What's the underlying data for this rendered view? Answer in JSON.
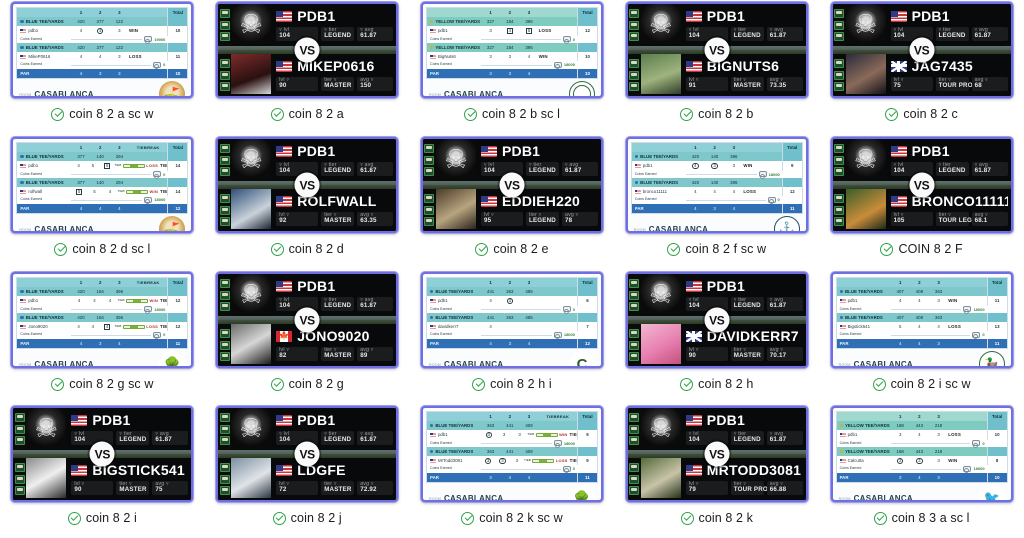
{
  "page": {
    "layout": "gallery-grid",
    "columns": 5,
    "rows": 4,
    "accent_border": "#6f6fe0",
    "check_color": "#2fa34a"
  },
  "labels": {
    "vs": "VS",
    "room_label": "ROOM",
    "prize_label": "PRIZE",
    "room_value": "CASABLANCA",
    "prize_value": "18000",
    "par_label": "PAR",
    "total_label": "Total",
    "tiebreak_label": "TIEBREAK",
    "coins_earned_label": "Coins Earned",
    "blue_tee": "BLUE TEE/YARDS",
    "yellow_tee": "YELLOW TEE/YARDS",
    "lvl_label": "lvl",
    "tier_label": "tier",
    "avg_label": "avg",
    "result_win": "WIN",
    "result_loss": "LOSS",
    "result_tie": "TIE"
  },
  "hero": {
    "name": "PDB1",
    "flag": "us",
    "lvl": "104",
    "tier": "LEGEND",
    "avg": "61.87",
    "avatar": "skull"
  },
  "items": [
    {
      "kind": "scorecard",
      "caption": "coin 8 2 a sc w",
      "tee": "blue",
      "logo": "lg-1",
      "rows": [
        {
          "type": "tee",
          "cells": [
            "420",
            "377",
            "122"
          ]
        },
        {
          "type": "player",
          "name": "pdb1",
          "cells": [
            "4",
            "3",
            "3"
          ],
          "marks": [
            "",
            "circle",
            ""
          ],
          "result": "WIN",
          "total": "10",
          "coins": "19000"
        },
        {
          "type": "tee",
          "cells": [
            "420",
            "377",
            "122"
          ]
        },
        {
          "type": "player",
          "name": "MikeP0616",
          "cells": [
            "4",
            "4",
            "3"
          ],
          "marks": [
            "",
            "",
            ""
          ],
          "result": "LOSS",
          "total": "11",
          "coins": "0"
        }
      ],
      "par": [
        "4",
        "3",
        "3"
      ],
      "par_total": "10"
    },
    {
      "kind": "vs",
      "caption": "coin 8 2 a",
      "opponent": {
        "name": "MIKEP0616",
        "flag": "us",
        "lvl": "90",
        "tier": "MASTER",
        "avg": "150",
        "avatar": "av-photo-1"
      }
    },
    {
      "kind": "scorecard",
      "caption": "coin 8 2 b sc l",
      "tee": "yellow",
      "logo": "lg-2",
      "rows": [
        {
          "type": "tee",
          "cells": [
            "327",
            "184",
            "396"
          ]
        },
        {
          "type": "player",
          "name": "pdb1",
          "cells": [
            "3",
            "4",
            "5"
          ],
          "marks": [
            "",
            "square",
            "square"
          ],
          "result": "LOSS",
          "total": "12",
          "coins": "0"
        },
        {
          "type": "tee",
          "cells": [
            "327",
            "184",
            "396"
          ]
        },
        {
          "type": "player",
          "name": "BigNuts6",
          "cells": [
            "3",
            "3",
            "4"
          ],
          "marks": [
            "",
            "",
            ""
          ],
          "result": "WIN",
          "total": "10",
          "coins": "18000"
        }
      ],
      "par": [
        "3",
        "3",
        "4"
      ],
      "par_total": "10"
    },
    {
      "kind": "vs",
      "caption": "coin 8 2 b",
      "opponent": {
        "name": "BIGNUTS6",
        "flag": "us",
        "lvl": "91",
        "tier": "MASTER",
        "avg": "73.35",
        "avatar": "av-photo-2"
      }
    },
    {
      "kind": "vs",
      "caption": "coin 8 2 c",
      "opponent": {
        "name": "JAG7435",
        "flag": "uk",
        "lvl": "75",
        "tier": "TOUR PRO",
        "avg": "68",
        "avatar": "av-photo-6"
      }
    },
    {
      "kind": "scorecard",
      "caption": "coin 8 2 d sc l",
      "tee": "blue",
      "logo": "lg-1",
      "tiebreak": true,
      "rows": [
        {
          "type": "tee",
          "cells": [
            "377",
            "140",
            "294"
          ]
        },
        {
          "type": "player",
          "name": "pdb1",
          "cells": [
            "4",
            "5",
            "5"
          ],
          "marks": [
            "",
            "",
            "square"
          ],
          "result": "TIE",
          "total": "14",
          "coins": "0",
          "tb": "LOSS"
        },
        {
          "type": "tee",
          "cells": [
            "377",
            "140",
            "294"
          ]
        },
        {
          "type": "player",
          "name": "rolfwall",
          "cells": [
            "5",
            "5",
            "4"
          ],
          "marks": [
            "square",
            "",
            ""
          ],
          "result": "TIE",
          "total": "14",
          "coins": "18000",
          "tb": "WIN"
        }
      ],
      "par": [
        "4",
        "4",
        "4"
      ],
      "par_total": "12"
    },
    {
      "kind": "vs",
      "caption": "coin 8 2 d",
      "opponent": {
        "name": "ROLFWALL",
        "flag": "us",
        "lvl": "92",
        "tier": "MASTER",
        "avg": "63.35",
        "avatar": "av-photo-3"
      }
    },
    {
      "kind": "vs",
      "caption": "coin 8 2 e",
      "opponent": {
        "name": "EDDIEH220",
        "flag": "us",
        "lvl": "95",
        "tier": "LEGEND",
        "avg": "78",
        "avatar": "av-photo-4"
      }
    },
    {
      "kind": "scorecard",
      "caption": "coin 8 2 f sc w",
      "tee": "blue",
      "logo": "lg-4",
      "rows": [
        {
          "type": "tee",
          "cells": [
            "420",
            "140",
            "396"
          ]
        },
        {
          "type": "player",
          "name": "pdb1",
          "cells": [
            "4",
            "3",
            "3"
          ],
          "marks": [
            "circle",
            "circle",
            ""
          ],
          "result": "WIN",
          "total": "9",
          "coins": "18000"
        },
        {
          "type": "tee",
          "cells": [
            "420",
            "140",
            "396"
          ]
        },
        {
          "type": "player",
          "name": "bronco11111",
          "cells": [
            "4",
            "4",
            "4"
          ],
          "marks": [
            "",
            "",
            ""
          ],
          "result": "LOSS",
          "total": "12",
          "coins": "0"
        }
      ],
      "par": [
        "4",
        "3",
        "4"
      ],
      "par_total": "11"
    },
    {
      "kind": "vs",
      "caption": "COIN 8 2 F",
      "opponent": {
        "name": "BRONCO11111",
        "flag": "us",
        "lvl": "105",
        "tier": "TOUR LEGEND",
        "avg": "68.1",
        "avatar": "av-photo-8"
      }
    },
    {
      "kind": "scorecard",
      "caption": "coin 8 2 g sc w",
      "tee": "blue",
      "logo": "lg-6",
      "tiebreak": true,
      "rows": [
        {
          "type": "tee",
          "cells": [
            "420",
            "184",
            "396"
          ]
        },
        {
          "type": "player",
          "name": "pdb1",
          "cells": [
            "4",
            "4",
            "4"
          ],
          "marks": [
            "",
            "",
            ""
          ],
          "result": "TIE",
          "total": "12",
          "coins": "18000",
          "tb": "WIN"
        },
        {
          "type": "tee",
          "cells": [
            "420",
            "184",
            "396"
          ]
        },
        {
          "type": "player",
          "name": "Jono9020",
          "cells": [
            "4",
            "4",
            "4"
          ],
          "marks": [
            "",
            "",
            "square"
          ],
          "result": "TIE",
          "total": "12",
          "coins": "0",
          "tb": "LOSS"
        }
      ],
      "par": [
        "4",
        "3",
        "4"
      ],
      "par_total": "11"
    },
    {
      "kind": "vs",
      "caption": "coin 8 2 g",
      "opponent": {
        "name": "JONO9020",
        "flag": "ca",
        "lvl": "82",
        "tier": "MASTER",
        "avg": "89",
        "avatar": "av-photo-5"
      }
    },
    {
      "kind": "scorecard",
      "caption": "coin 8 2 h i",
      "tee": "blue",
      "logo": "lg-3",
      "rows": [
        {
          "type": "tee",
          "cells": [
            "441",
            "363",
            "485"
          ]
        },
        {
          "type": "player",
          "name": "pdb1",
          "cells": [
            "4",
            "3",
            ""
          ],
          "marks": [
            "",
            "circle",
            ""
          ],
          "result": "",
          "total": "6",
          "coins": "0"
        },
        {
          "type": "tee",
          "cells": [
            "441",
            "363",
            "485"
          ]
        },
        {
          "type": "player",
          "name": "davidkerr7",
          "cells": [
            "4",
            "",
            ""
          ],
          "marks": [
            "",
            "",
            ""
          ],
          "result": "",
          "total": "7",
          "coins": "18000"
        }
      ],
      "par": [
        "4",
        "3",
        "4"
      ],
      "par_total": "12"
    },
    {
      "kind": "vs",
      "caption": "coin 8 2 h",
      "opponent": {
        "name": "DAVIDKERR7",
        "flag": "uk",
        "lvl": "90",
        "tier": "MASTER",
        "avg": "70.17",
        "avatar": "av-photo-7"
      }
    },
    {
      "kind": "scorecard",
      "caption": "coin 8 2 i sc w",
      "tee": "blue",
      "logo": "lg-5",
      "rows": [
        {
          "type": "tee",
          "cells": [
            "407",
            "408",
            "363"
          ]
        },
        {
          "type": "player",
          "name": "pdb1",
          "cells": [
            "4",
            "4",
            "3"
          ],
          "marks": [
            "",
            "",
            ""
          ],
          "result": "WIN",
          "total": "11",
          "coins": "18000"
        },
        {
          "type": "tee",
          "cells": [
            "407",
            "408",
            "363"
          ]
        },
        {
          "type": "player",
          "name": "Bigstick541",
          "cells": [
            "5",
            "4",
            "4"
          ],
          "marks": [
            "",
            "",
            ""
          ],
          "result": "LOSS",
          "total": "13",
          "coins": "0"
        }
      ],
      "par": [
        "4",
        "4",
        "3"
      ],
      "par_total": "11"
    },
    {
      "kind": "vs",
      "caption": "coin 8 2 i",
      "opponent": {
        "name": "BIGSTICK541",
        "flag": "us",
        "lvl": "90",
        "tier": "MASTER",
        "avg": "75",
        "avatar": "av-photo-11"
      }
    },
    {
      "kind": "vs",
      "caption": "coin 8 2 j",
      "opponent": {
        "name": "LDGFE",
        "flag": "us",
        "lvl": "72",
        "tier": "MASTER",
        "avg": "72.92",
        "avatar": "av-photo-9"
      }
    },
    {
      "kind": "scorecard",
      "caption": "coin 8 2 k sc w",
      "tee": "blue",
      "logo": "lg-6",
      "tiebreak": true,
      "rows": [
        {
          "type": "tee",
          "cells": [
            "363",
            "441",
            "408"
          ]
        },
        {
          "type": "player",
          "name": "pdb1",
          "cells": [
            "3",
            "3",
            "3"
          ],
          "marks": [
            "circle",
            "",
            ""
          ],
          "result": "TIE",
          "total": "9",
          "coins": "18000",
          "tb": "WIN"
        },
        {
          "type": "tee",
          "cells": [
            "363",
            "441",
            "408"
          ]
        },
        {
          "type": "player",
          "name": "MrTodd3081",
          "cells": [
            "3",
            "3",
            "3"
          ],
          "marks": [
            "circle",
            "circle",
            ""
          ],
          "result": "TIE",
          "total": "9",
          "coins": "0",
          "tb": "LOSS"
        }
      ],
      "par": [
        "3",
        "4",
        "4"
      ],
      "par_total": "11"
    },
    {
      "kind": "vs",
      "caption": "coin 8 2 k",
      "opponent": {
        "name": "MRTODD3081",
        "flag": "us",
        "lvl": "79",
        "tier": "TOUR PRO",
        "avg": "66.88",
        "avatar": "av-photo-10"
      }
    },
    {
      "kind": "scorecard",
      "caption": "coin 8 3 a sc l",
      "tee": "yellow",
      "logo": "lg-7",
      "rows": [
        {
          "type": "tee",
          "cells": [
            "188",
            "443",
            "218"
          ]
        },
        {
          "type": "player",
          "name": "pdb1",
          "cells": [
            "3",
            "4",
            "3"
          ],
          "marks": [
            "",
            "",
            ""
          ],
          "result": "LOSS",
          "total": "10",
          "coins": "0"
        },
        {
          "type": "tee",
          "cells": [
            "188",
            "443",
            "218"
          ]
        },
        {
          "type": "player",
          "name": "Calcutta",
          "cells": [
            "2",
            "3",
            "3"
          ],
          "marks": [
            "circle",
            "circle",
            ""
          ],
          "result": "WIN",
          "total": "8",
          "coins": "18000"
        }
      ],
      "par": [
        "3",
        "4",
        "3"
      ],
      "par_total": "10"
    }
  ]
}
